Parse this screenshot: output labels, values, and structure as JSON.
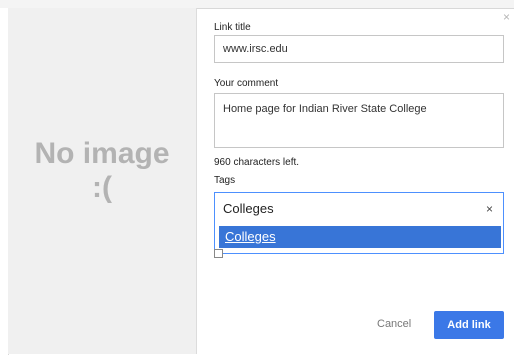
{
  "background": {
    "partial_title": ""
  },
  "image_panel": {
    "placeholder_line1": "No image",
    "placeholder_line2": ":("
  },
  "dialog": {
    "close_glyph": "×"
  },
  "link_title": {
    "label": "Link title",
    "value": "www.irsc.edu"
  },
  "comment": {
    "label": "Your comment",
    "value": "Home page for Indian River State College",
    "chars_left": "960 characters left."
  },
  "tags": {
    "label": "Tags",
    "value": "Colleges",
    "clear_glyph": "×",
    "suggestions": [
      "Colleges"
    ]
  },
  "actions": {
    "cancel_label": "Cancel",
    "add_label": "Add link"
  },
  "colors": {
    "accent": "#3b78e7",
    "highlight": "#3875d7",
    "focus_border": "#4d90fe"
  }
}
